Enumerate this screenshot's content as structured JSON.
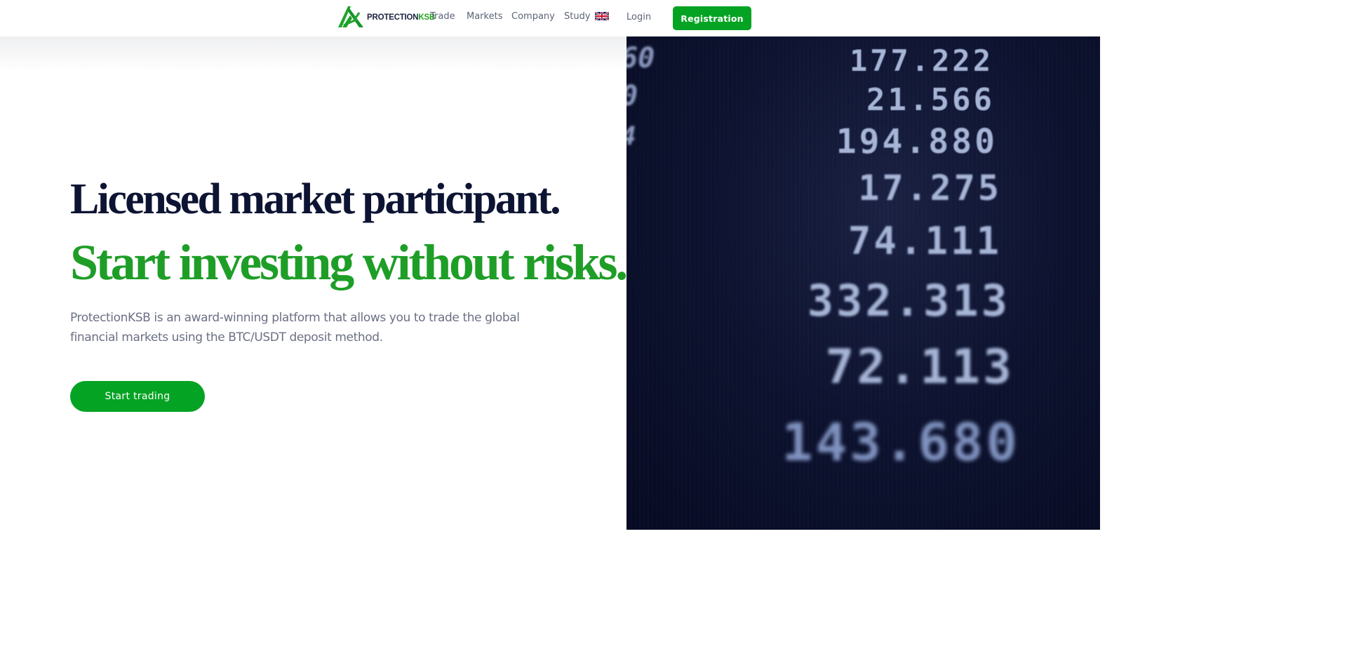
{
  "brand": {
    "logo_primary": "PROTECTION",
    "logo_accent": "KSB",
    "accent_color": "#05a324",
    "logo_icon": "protectionksb-logo-icon"
  },
  "nav": {
    "items": [
      {
        "label": "Trade"
      },
      {
        "label": "Markets"
      },
      {
        "label": "Company"
      },
      {
        "label": "Study"
      }
    ],
    "language_icon": "uk-flag-icon",
    "login_label": "Login",
    "registration_label": "Registration"
  },
  "hero": {
    "headline_line1": "Licensed market participant.",
    "headline_line2": "Start investing without risks.",
    "description": "ProtectionKSB is an award-winning platform that allows you to trade the global financial markets using the BTC/USDT deposit method.",
    "cta_label": "Start trading",
    "headline1_color": "#0d1433",
    "headline2_color": "#1e9e27"
  },
  "ticker_image": {
    "values": [
      "177.222",
      "21.566",
      "194.880",
      "17.275",
      "74.111",
      "332.313",
      "72.113",
      "143.680"
    ],
    "edge_fragments": [
      "60",
      "0",
      "4"
    ]
  }
}
